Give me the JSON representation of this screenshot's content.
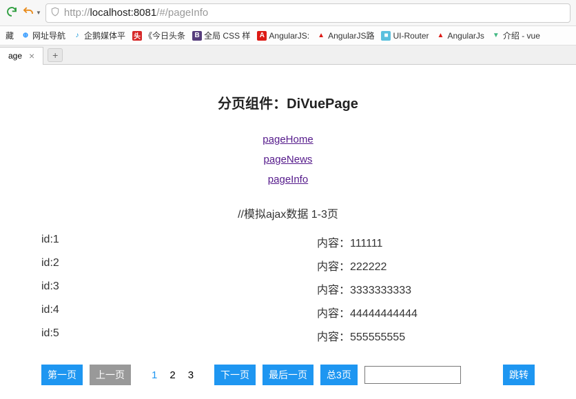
{
  "url": {
    "prefix": "http://",
    "host": "localhost:8081",
    "path": "/#/pageInfo"
  },
  "bookmarks": [
    {
      "label": "藏"
    },
    {
      "label": "网址导航"
    },
    {
      "label": "企鹅媒体平"
    },
    {
      "label": "《今日头条"
    },
    {
      "label": "全局 CSS 样"
    },
    {
      "label": "AngularJS:"
    },
    {
      "label": "AngularJS路"
    },
    {
      "label": "UI-Router"
    },
    {
      "label": "AngularJs"
    },
    {
      "label": "介绍 - vue"
    }
  ],
  "tab": {
    "label": "age"
  },
  "page": {
    "title": "分页组件：DiVuePage",
    "links": [
      {
        "label": "pageHome"
      },
      {
        "label": "pageNews"
      },
      {
        "label": "pageInfo"
      }
    ],
    "subtitle": "//模拟ajax数据 1-3页",
    "rows": [
      {
        "id": "id:1",
        "content": "内容：111111"
      },
      {
        "id": "id:2",
        "content": "内容：222222"
      },
      {
        "id": "id:3",
        "content": "内容：3333333333"
      },
      {
        "id": "id:4",
        "content": "内容：44444444444"
      },
      {
        "id": "id:5",
        "content": "内容：555555555"
      }
    ],
    "pager": {
      "first": "第一页",
      "prev": "上一页",
      "pages": [
        "1",
        "2",
        "3"
      ],
      "current": 1,
      "next": "下一页",
      "last": "最后一页",
      "total": "总3页",
      "go": "跳转"
    }
  }
}
